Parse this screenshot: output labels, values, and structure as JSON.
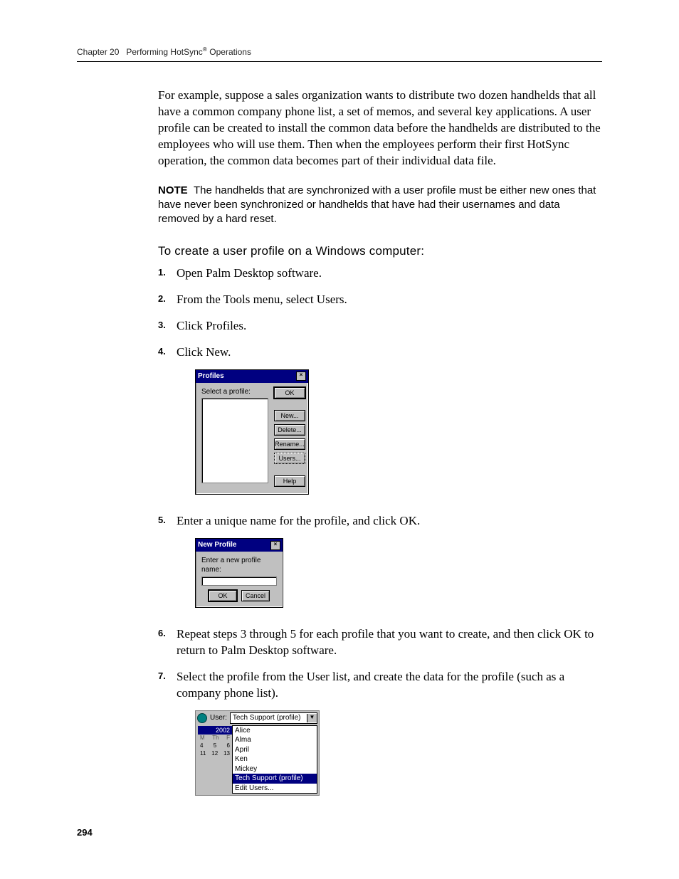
{
  "header": {
    "chapter": "Chapter 20",
    "title": "Performing HotSync",
    "reg_mark": "®",
    "title_suffix": " Operations"
  },
  "intro_paragraph": "For example, suppose a sales organization wants to distribute two dozen handhelds that all have a common company phone list, a set of memos, and several key applications. A user profile can be created to install the common data before the handhelds are distributed to the employees who will use them. Then when the employees perform their first HotSync operation, the common data becomes part of their individual data file.",
  "note": {
    "label": "NOTE",
    "text": "The handhelds that are synchronized with a user profile must be either new ones that have never been synchronized or handhelds that have had their usernames and data removed by a hard reset."
  },
  "section_heading": "To create a user profile on a Windows computer:",
  "steps": [
    {
      "n": "1.",
      "text": "Open Palm Desktop software."
    },
    {
      "n": "2.",
      "text": "From the Tools menu, select Users."
    },
    {
      "n": "3.",
      "text": "Click Profiles."
    },
    {
      "n": "4.",
      "text": "Click New."
    },
    {
      "n": "5.",
      "text": "Enter a unique name for the profile, and click OK."
    },
    {
      "n": "6.",
      "text": "Repeat steps 3 through 5 for each profile that you want to create, and then click OK to return to Palm Desktop software."
    },
    {
      "n": "7.",
      "text": "Select the profile from the User list, and create the data for the profile (such as a company phone list)."
    }
  ],
  "profiles_dialog": {
    "title": "Profiles",
    "label": "Select a profile:",
    "buttons": {
      "ok": "OK",
      "new": "New...",
      "delete": "Delete...",
      "rename": "Rename...",
      "users": "Users...",
      "help": "Help"
    }
  },
  "new_profile_dialog": {
    "title": "New Profile",
    "label": "Enter a new profile name:",
    "ok": "OK",
    "cancel": "Cancel"
  },
  "user_dropdown": {
    "label": "User:",
    "selected": "Tech Support (profile)",
    "year": "2002",
    "day_headers": [
      "M",
      "Th",
      "F"
    ],
    "day_rows": [
      [
        "4",
        "5",
        "6"
      ],
      [
        "11",
        "12",
        "13"
      ]
    ],
    "options": [
      "Alice",
      "Alma",
      "April",
      "Ken",
      "Mickey",
      "Tech Support (profile)",
      "Edit Users..."
    ]
  },
  "page_number": "294"
}
